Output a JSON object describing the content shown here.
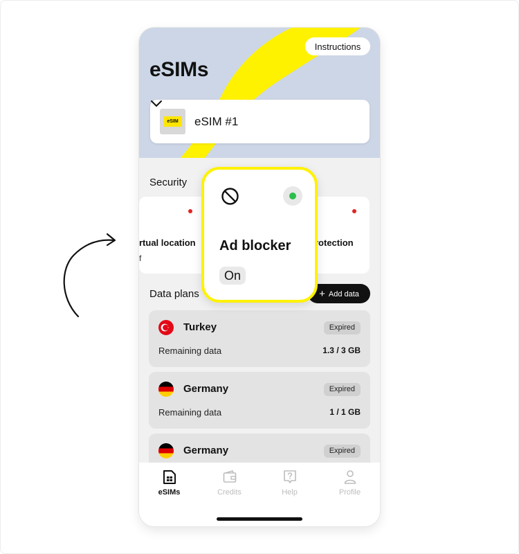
{
  "header": {
    "title": "eSIMs",
    "instructions_label": "Instructions"
  },
  "esim_selector": {
    "chip_text": "eSIM",
    "selected": "eSIM #1"
  },
  "security": {
    "title": "Security",
    "items": [
      {
        "label": "rtual location",
        "state_fragment": "f"
      },
      {
        "label": "rotection"
      }
    ]
  },
  "ad_blocker": {
    "title": "Ad blocker",
    "state": "On"
  },
  "data_plans": {
    "title": "Data plans",
    "add_label": "Add data",
    "items": [
      {
        "country": "Turkey",
        "status": "Expired",
        "remaining_label": "Remaining data",
        "remaining_value": "1.3 / 3 GB"
      },
      {
        "country": "Germany",
        "status": "Expired",
        "remaining_label": "Remaining data",
        "remaining_value": "1 / 1 GB"
      },
      {
        "country": "Germany",
        "status": "Expired"
      }
    ]
  },
  "bottom_nav": [
    {
      "label": "eSIMs",
      "icon": "sim-card-icon",
      "active": true
    },
    {
      "label": "Credits",
      "icon": "wallet-icon",
      "active": false
    },
    {
      "label": "Help",
      "icon": "help-icon",
      "active": false
    },
    {
      "label": "Profile",
      "icon": "person-icon",
      "active": false
    }
  ],
  "colors": {
    "accent_yellow": "#fff200",
    "hero_blue": "#ccd6e6",
    "status_green": "#2bbf4b",
    "status_red": "#e02424"
  }
}
